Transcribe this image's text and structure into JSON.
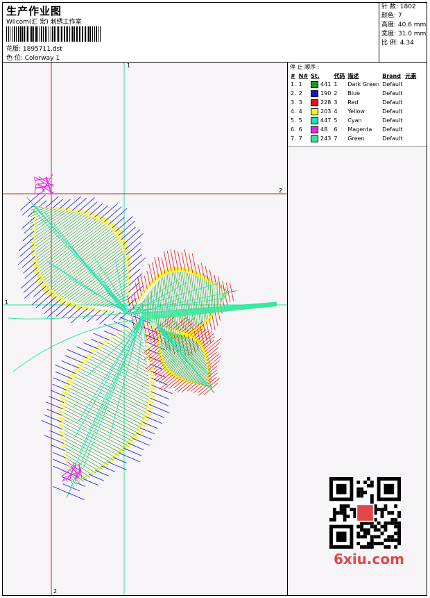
{
  "header": {
    "title": "生产作业图",
    "company": "Wilcom(汇 宏) 刺绣工作室",
    "design": "花版: 1895711.dst",
    "colorway": "色 位: Colorway 1"
  },
  "stats": {
    "stitches": "针 数: 1802",
    "colors": "颜色: 7",
    "height": "高度: 40.6 mm",
    "width": "宽度: 31.0 mm",
    "scale": "比 例: 4.34"
  },
  "legend": {
    "title": "停 止 顺序 :",
    "headers": [
      "#",
      "N#",
      "St.",
      "代码",
      "描述",
      "Brand",
      "元素"
    ],
    "rows": [
      {
        "n": "1.",
        "num": "1",
        "color": "#1a9b1a",
        "st": "441",
        "code": "1",
        "desc": "Dark Green",
        "brand": "Default"
      },
      {
        "n": "2.",
        "num": "2",
        "color": "#1414d8",
        "st": "190",
        "code": "2",
        "desc": "Blue",
        "brand": "Default"
      },
      {
        "n": "3.",
        "num": "3",
        "color": "#ee1111",
        "st": "228",
        "code": "3",
        "desc": "Red",
        "brand": "Default"
      },
      {
        "n": "4.",
        "num": "4",
        "color": "#f4f41a",
        "st": "203",
        "code": "4",
        "desc": "Yellow",
        "brand": "Default"
      },
      {
        "n": "5.",
        "num": "5",
        "color": "#22e0b8",
        "st": "447",
        "code": "5",
        "desc": "Cyan",
        "brand": "Default"
      },
      {
        "n": "6.",
        "num": "6",
        "color": "#ee22ee",
        "st": "48",
        "code": "6",
        "desc": "Magenta",
        "brand": "Default"
      },
      {
        "n": "7.",
        "num": "7",
        "color": "#33e899",
        "st": "243",
        "code": "7",
        "desc": "Green",
        "brand": "Default"
      }
    ]
  },
  "guides": {
    "v1": "1",
    "h2": "2",
    "h1": "1",
    "v2": "2"
  },
  "watermark": "6xiu.com"
}
